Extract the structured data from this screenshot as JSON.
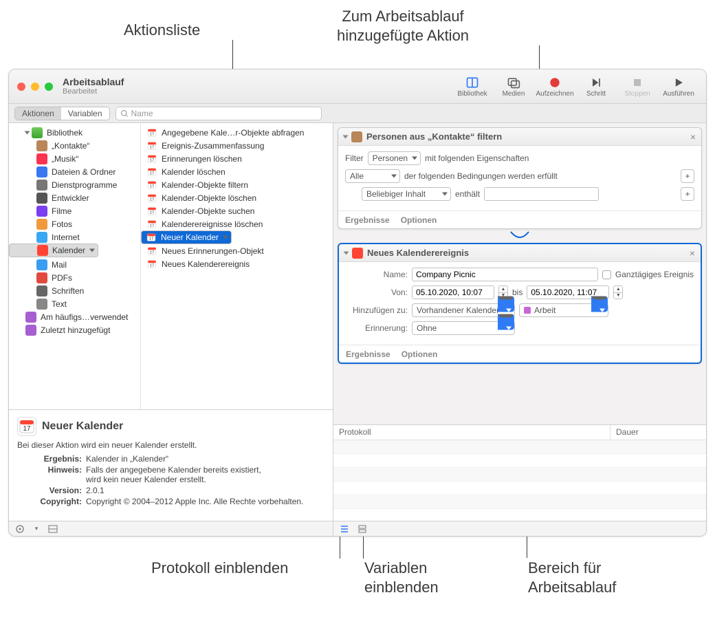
{
  "callouts": {
    "actionList": "Aktionsliste",
    "addedAction": "Zum Arbeitsablauf\nhinzugefügte Aktion",
    "showLog": "Protokoll einblenden",
    "showVars": "Variablen\neinblenden",
    "workflowArea": "Bereich für\nArbeitsablauf"
  },
  "window": {
    "title": "Arbeitsablauf",
    "subtitle": "Bearbeitet"
  },
  "toolbar": {
    "library": "Bibliothek",
    "media": "Medien",
    "record": "Aufzeichnen",
    "step": "Schritt",
    "stop": "Stoppen",
    "run": "Ausführen"
  },
  "subbar": {
    "actions": "Aktionen",
    "variables": "Variablen",
    "searchPlaceholder": "Name"
  },
  "library": {
    "header": "Bibliothek",
    "items": [
      {
        "label": "„Kontakte“",
        "color": "#b8865a"
      },
      {
        "label": "„Musik“",
        "color": "#fa3351"
      },
      {
        "label": "Dateien & Ordner",
        "color": "#3a78f2"
      },
      {
        "label": "Dienstprogramme",
        "color": "#777"
      },
      {
        "label": "Entwickler",
        "color": "#555"
      },
      {
        "label": "Filme",
        "color": "#7b3ff2"
      },
      {
        "label": "Fotos",
        "color": "#f09a3e"
      },
      {
        "label": "Internet",
        "color": "#3aa7f2"
      },
      {
        "label": "Kalender",
        "color": "#ff4433",
        "selected": true
      },
      {
        "label": "Mail",
        "color": "#3a9df2"
      },
      {
        "label": "PDFs",
        "color": "#e04a3f"
      },
      {
        "label": "Schriften",
        "color": "#666"
      },
      {
        "label": "Text",
        "color": "#888"
      }
    ],
    "smart": [
      {
        "label": "Am häufigs…verwendet",
        "color": "#a65fd0"
      },
      {
        "label": "Zuletzt hinzugefügt",
        "color": "#a65fd0"
      }
    ]
  },
  "actions": [
    "Angegebene Kale…r-Objekte abfragen",
    "Ereignis-Zusammenfassung",
    "Erinnerungen löschen",
    "Kalender löschen",
    "Kalender-Objekte filtern",
    "Kalender-Objekte löschen",
    "Kalender-Objekte suchen",
    "Kalenderereignisse löschen",
    "Neuer Kalender",
    "Neues Erinnerungen-Objekt",
    "Neues Kalenderereignis"
  ],
  "actionSelectedIndex": 8,
  "info": {
    "title": "Neuer Kalender",
    "desc": "Bei dieser Aktion wird ein neuer Kalender erstellt.",
    "rows": {
      "resultLbl": "Ergebnis:",
      "resultVal": "Kalender in „Kalender“",
      "hintLbl": "Hinweis:",
      "hintVal": "Falls der angegebene Kalender bereits existiert,\nwird kein neuer Kalender erstellt.",
      "versionLbl": "Version:",
      "versionVal": "2.0.1",
      "copyLbl": "Copyright:",
      "copyVal": "Copyright © 2004–2012 Apple Inc. Alle Rechte vorbehalten."
    }
  },
  "wf": {
    "card1": {
      "title": "Personen aus „Kontakte“ filtern",
      "filterLbl": "Filter",
      "filterSel": "Personen",
      "filterTail": "mit folgenden Eigenschaften",
      "condSel": "Alle",
      "condTail": "der folgenden Bedingungen werden erfüllt",
      "subSel": "Beliebiger Inhalt",
      "subOp": "enthält"
    },
    "card2": {
      "title": "Neues Kalenderereignis",
      "nameLbl": "Name:",
      "nameVal": "Company Picnic",
      "allDay": "Ganztägiges Ereignis",
      "fromLbl": "Von:",
      "fromVal": "05.10.2020, 10:07",
      "to": "bis",
      "toVal": "05.10.2020, 11:07",
      "addToLbl": "Hinzufügen zu:",
      "addToSel": "Vorhandener Kalender",
      "calSel": "Arbeit",
      "remLbl": "Erinnerung:",
      "remSel": "Ohne"
    },
    "footer": {
      "results": "Ergebnisse",
      "options": "Optionen"
    }
  },
  "log": {
    "col1": "Protokoll",
    "col2": "Dauer"
  }
}
